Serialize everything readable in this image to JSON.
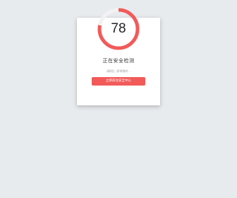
{
  "security_check": {
    "score": "78",
    "score_fraction": 0.78,
    "status_title": "正在安全检测",
    "status_subtitle": "请稍后, 即将跳转...",
    "button_label": "立即前往安全中心"
  },
  "colors": {
    "background": "#e8ebee",
    "card": "#ffffff",
    "accent": "#f25a5a",
    "gauge_track": "#f2f2f2",
    "score_text": "#222222"
  }
}
